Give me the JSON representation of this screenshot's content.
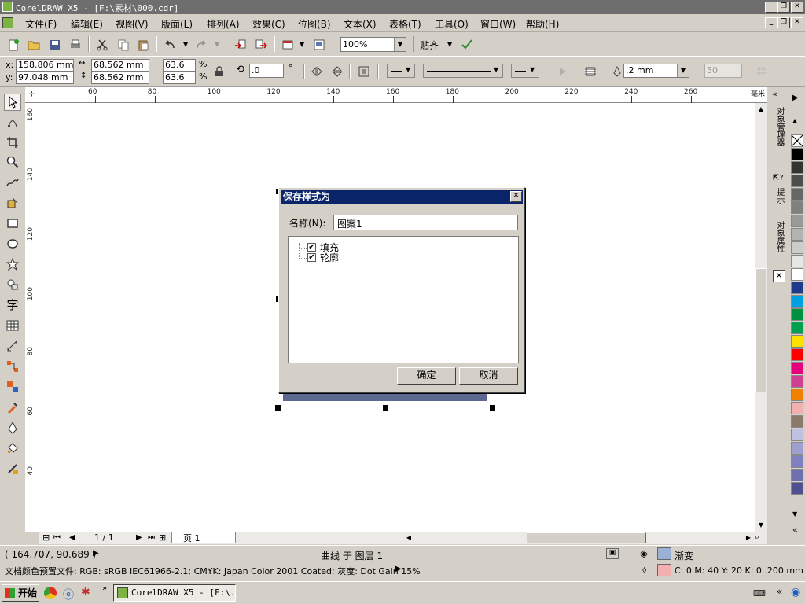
{
  "window": {
    "title": "CorelDRAW X5 - [F:\\素材\\000.cdr]"
  },
  "menus": [
    "文件(F)",
    "编辑(E)",
    "视图(V)",
    "版面(L)",
    "排列(A)",
    "效果(C)",
    "位图(B)",
    "文本(X)",
    "表格(T)",
    "工具(O)",
    "窗口(W)",
    "帮助(H)"
  ],
  "toolbar": {
    "zoom": "100%",
    "snap_label": "贴齐"
  },
  "props": {
    "x_label": "x:",
    "x_value": "158.806 mm",
    "y_label": "y:",
    "y_value": "97.048 mm",
    "width": "68.562 mm",
    "height": "68.562 mm",
    "scale_w": "63.6",
    "scale_h": "63.6",
    "percent": "%",
    "rotation": ".0",
    "degree": "°",
    "outline_width": ".2 mm",
    "disabled_value": "50"
  },
  "ruler": {
    "h_ticks": [
      "60",
      "80",
      "100",
      "120",
      "140",
      "160",
      "180",
      "200",
      "220",
      "240",
      "260"
    ],
    "h_unit": "毫米",
    "v_ticks": [
      "160",
      "140",
      "120",
      "100",
      "80",
      "60",
      "40"
    ]
  },
  "dialog": {
    "title": "保存样式为",
    "name_label": "名称(N):",
    "name_value": "图案1",
    "items": [
      {
        "label": "填充",
        "checked": true
      },
      {
        "label": "轮廓",
        "checked": true
      }
    ],
    "ok": "确定",
    "cancel": "取消"
  },
  "page_nav": {
    "counter": "1 / 1",
    "tab": "页 1"
  },
  "docker_tabs": [
    "对象管理器",
    "提示",
    "对象属性"
  ],
  "palette": [
    "#000000",
    "#333333",
    "#4d4d4d",
    "#666666",
    "#808080",
    "#999999",
    "#b3b3b3",
    "#cccccc",
    "#e6e6e6",
    "#ffffff",
    "#1e3a8a",
    "#00a0e0",
    "#009040",
    "#00a050",
    "#ffe000",
    "#ff0000",
    "#e6007e",
    "#d04090",
    "#f08000",
    "#f4b0b0",
    "#8a7a6a",
    "#c0c0e0",
    "#a0a0d0",
    "#8080c0",
    "#7070b0",
    "#505090"
  ],
  "status": {
    "coords": "( 164.707, 90.689 )",
    "layer": "曲线 于 图层 1",
    "fill_label": "渐变",
    "profile": "文档颜色预置文件: RGB: sRGB IEC61966-2.1; CMYK: Japan Color 2001 Coated; 灰度: Dot Gain 15%",
    "outline": "C: 0 M: 40 Y: 20 K: 0  .200 mm"
  },
  "taskbar": {
    "start": "开始",
    "task": "CorelDRAW X5 - [F:\\..."
  }
}
